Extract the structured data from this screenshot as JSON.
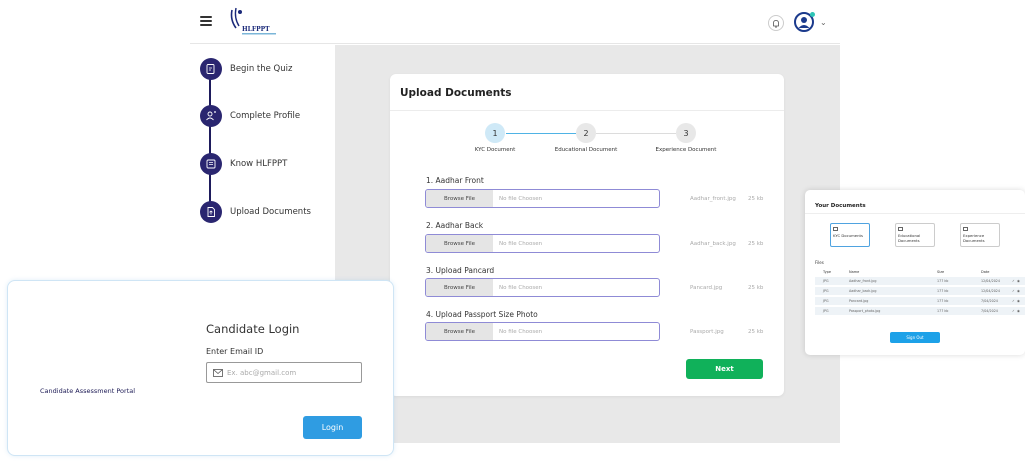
{
  "header": {
    "logo_text": "HLFPPT"
  },
  "sidebar": {
    "items": [
      {
        "label": "Begin the Quiz"
      },
      {
        "label": "Complete Profile"
      },
      {
        "label": "Know HLFPPT"
      },
      {
        "label": "Upload Documents"
      }
    ]
  },
  "upload": {
    "title": "Upload Documents",
    "steps": [
      {
        "num": "1",
        "label": "KYC Document"
      },
      {
        "num": "2",
        "label": "Educational Document"
      },
      {
        "num": "3",
        "label": "Experience Document"
      }
    ],
    "browse_label": "Browse File",
    "placeholder": "No file Choosen",
    "fields": [
      {
        "label": "1. Aadhar Front",
        "filename": "Aadhar_front.jpg",
        "size": "25 kb"
      },
      {
        "label": "2. Aadhar Back",
        "filename": "Aadhar_back.jpg",
        "size": "25 kb"
      },
      {
        "label": "3. Upload Pancard",
        "filename": "Pancard.jpg",
        "size": "25 kb"
      },
      {
        "label": "4. Upload Passport Size Photo",
        "filename": "Passport.jpg",
        "size": "25 kb"
      }
    ],
    "next_label": "Next"
  },
  "docs": {
    "title": "Your Documents",
    "categories": [
      {
        "label": "KYC Documents"
      },
      {
        "label": "Educational Documents"
      },
      {
        "label": "Experience Documents"
      }
    ],
    "files_label": "Files",
    "columns": [
      "Type",
      "Name",
      "Size",
      "Date"
    ],
    "rows": [
      {
        "type": "JPG",
        "name": "Aadhar_front.jpg",
        "size": "177 kb",
        "date": "12/04/2024"
      },
      {
        "type": "JPG",
        "name": "Aadhar_back.jpg",
        "size": "177 kb",
        "date": "12/04/2024"
      },
      {
        "type": "JPG",
        "name": "Pancard.jpg",
        "size": "177 kb",
        "date": "7/04/2024"
      },
      {
        "type": "JPG",
        "name": "Passport_photo.jpg",
        "size": "177 kb",
        "date": "7/04/2024"
      }
    ],
    "signout_label": "Sign Out"
  },
  "login": {
    "title": "Candidate Login",
    "email_label": "Enter Email ID",
    "email_placeholder": "Ex. abc@gmail.com",
    "portal_label": "Candidate Assessment Portal",
    "login_label": "Login"
  },
  "colors": {
    "primary": "#2a2670",
    "accent": "#10b15a",
    "link": "#2f9ce2"
  }
}
